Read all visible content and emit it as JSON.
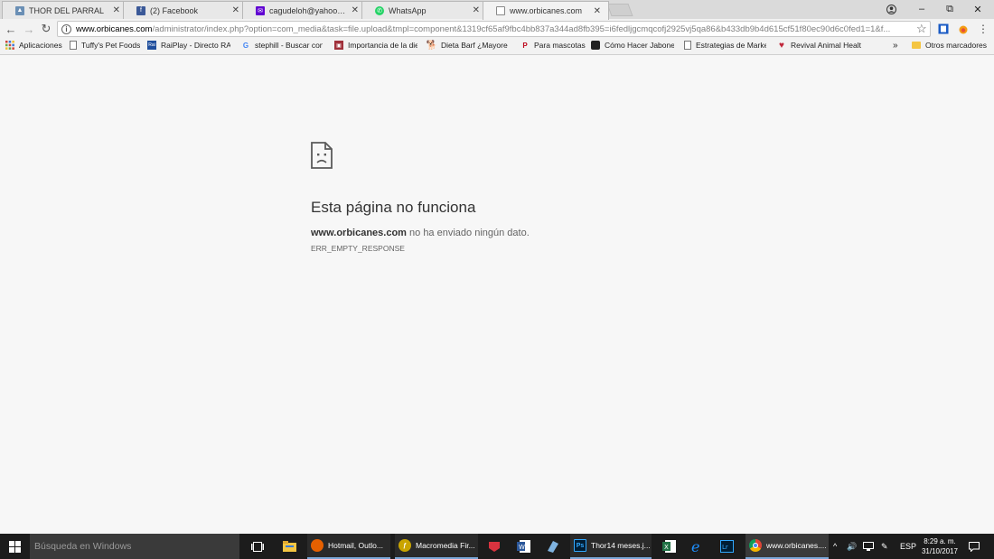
{
  "tabs": [
    {
      "title": "THOR DEL PARRAL",
      "favicon": "dog-favicon-icon",
      "color": "#6a8fb5"
    },
    {
      "title": "(2) Facebook",
      "favicon": "facebook-icon",
      "color": "#3b5998"
    },
    {
      "title": "cagudeloh@yahoo.es - Y",
      "favicon": "yahoo-mail-icon",
      "color": "#6001d2"
    },
    {
      "title": "WhatsApp",
      "favicon": "whatsapp-icon",
      "color": "#25d366"
    },
    {
      "title": "www.orbicanes.com",
      "favicon": "page-icon",
      "color": "#888888"
    }
  ],
  "address_bar": {
    "host": "www.orbicanes.com",
    "path": "/administrator/index.php?option=com_media&task=file.upload&tmpl=component&1319cf65af9fbc4bb837a344ad8fb395=i6fedljgcmqcofj2925vj5qa86&b433db9b4d615cf51f80ec90d6c0fed1=1&f..."
  },
  "bookmarks": [
    {
      "label": "Aplicaciones",
      "icon": "apps-grid-icon"
    },
    {
      "label": "Tuffy's Pet Foods",
      "icon": "page-icon"
    },
    {
      "label": "RaiPlay - Directo RAI",
      "icon": "raiplay-icon"
    },
    {
      "label": "stephill - Buscar con",
      "icon": "google-icon"
    },
    {
      "label": "Importancia de la die",
      "icon": "bookmark-site-icon"
    },
    {
      "label": "Dieta Barf ¿Mayores",
      "icon": "dog-icon"
    },
    {
      "label": "Para mascotas",
      "icon": "pinterest-icon"
    },
    {
      "label": "Cómo Hacer Jabones",
      "icon": "soap-icon"
    },
    {
      "label": "Estrategias de Marke",
      "icon": "page-icon"
    },
    {
      "label": "Revival Animal Health",
      "icon": "heart-icon"
    }
  ],
  "bookmarks_overflow": "»",
  "other_bookmarks": "Otros marcadores",
  "error": {
    "title": "Esta página no funciona",
    "host": "www.orbicanes.com",
    "message": " no ha enviado ningún dato.",
    "code": "ERR_EMPTY_RESPONSE"
  },
  "taskbar": {
    "search_placeholder": "Búsqueda en Windows",
    "apps": [
      {
        "label": "Hotmail, Outlo...",
        "icon": "firefox-icon",
        "color": "#e66000"
      },
      {
        "label": "Macromedia Fir...",
        "icon": "fireworks-icon",
        "color": "#c9a400"
      },
      {
        "label": "Thor14 meses.j...",
        "icon": "photoshop-icon",
        "color": "#001d34"
      },
      {
        "label": "www.orbicanes....",
        "icon": "chrome-icon",
        "color": "#db4437"
      }
    ],
    "language": "ESP",
    "time": "8:29 a. m.",
    "date": "31/10/2017"
  }
}
